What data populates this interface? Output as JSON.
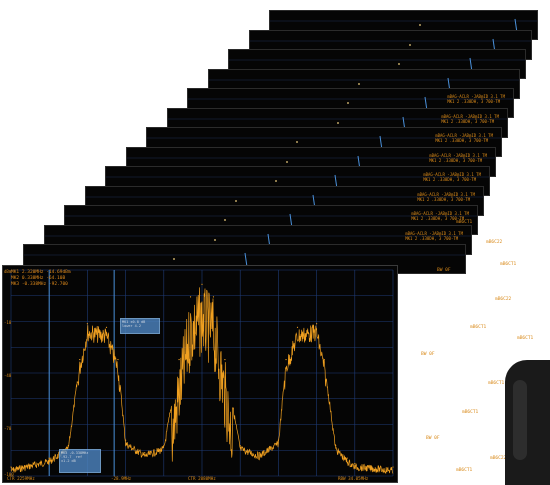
{
  "main_header": {
    "line1": "MK1 2.320MHz  -14.69dBm",
    "line2": "MK2 0.338MHz  -64.10B",
    "line3": "MK3 -0.338MHz  -92.700"
  },
  "y_axis_labels": [
    "dBm",
    "-10",
    "-40",
    "-70",
    "-100"
  ],
  "x_axis_labels": [
    "CTR 2259MHz",
    "-28.9MHz",
    "CTR 2080MHz",
    "RBW 34.05MHz"
  ],
  "marker_boxes": [
    {
      "text": "MK1 ±0.8 dB\nlower 4.2"
    },
    {
      "text": "MK3 -0.338MHz\n-92.7  ref\n±1.2 dB"
    }
  ],
  "stack_frame_text": [
    "mBAG-ACLR -JAB@ID 3.1 TM",
    "MK1 2 .338DH, 3 700-TM"
  ],
  "side_tags": [
    "mB6CT1",
    "mB6C22",
    "BW 0F",
    "mB6C22",
    "mB6CT1",
    "BW 0F",
    "mB6CT1",
    "mB6CT1",
    "BW 0F",
    "mB6C22",
    "mB6CT1",
    "mB6CT1",
    "mB6CT1"
  ],
  "chart_data": {
    "type": "line",
    "description": "Spectrum trace: two adjacent-channel blocks and a central main channel",
    "x": [
      0,
      0.1,
      0.15,
      0.18,
      0.2,
      0.25,
      0.28,
      0.3,
      0.35,
      0.4,
      0.44,
      0.47,
      0.5,
      0.53,
      0.56,
      0.6,
      0.65,
      0.7,
      0.72,
      0.75,
      0.8,
      0.82,
      0.85,
      0.88,
      0.9,
      1.0
    ],
    "y": [
      -100,
      -95,
      -88,
      -40,
      -20,
      -22,
      -40,
      -85,
      -92,
      -88,
      -40,
      -5,
      2,
      -5,
      -40,
      -88,
      -92,
      -85,
      -40,
      -22,
      -20,
      -40,
      -88,
      -95,
      -98,
      -100
    ],
    "ylim": [
      -105,
      10
    ],
    "xlim": [
      0,
      1
    ],
    "grid": true,
    "colors": {
      "trace": "#f0a020",
      "grid": "#1e3c78",
      "marker": "#4a90d9",
      "text": "#e08b1c"
    }
  }
}
